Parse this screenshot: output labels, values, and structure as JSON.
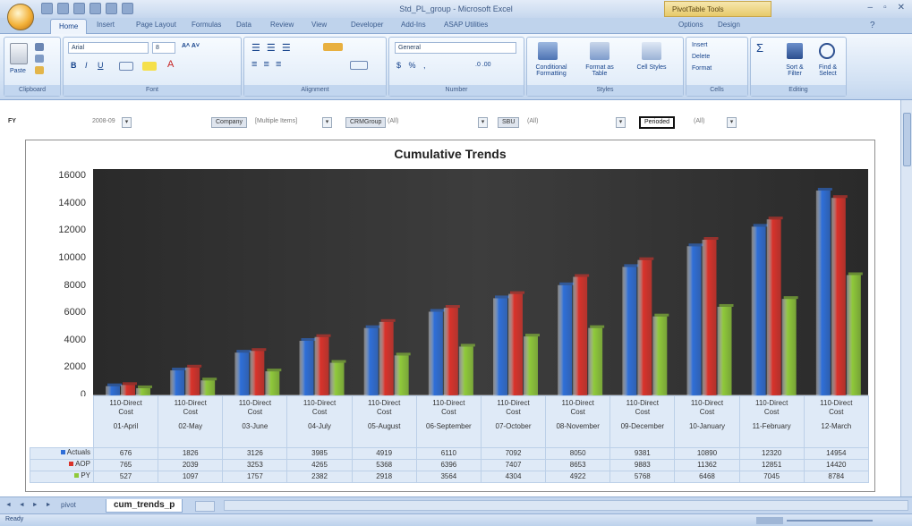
{
  "window": {
    "title": "Std_PL_group - Microsoft Excel",
    "contextual_tab": "PivotTable Tools",
    "controls": [
      "–",
      "▫",
      "✕"
    ]
  },
  "ribbon_tabs": [
    "Home",
    "Insert",
    "Page Layout",
    "Formulas",
    "Data",
    "Review",
    "View",
    "Developer",
    "Add-Ins",
    "ASAP Utilities",
    "Options",
    "Design"
  ],
  "ribbon": {
    "clipboard": {
      "paste": "Paste",
      "label": "Clipboard"
    },
    "font": {
      "name": "Arial",
      "size": "8",
      "label": "Font"
    },
    "alignment": {
      "label": "Alignment"
    },
    "number": {
      "format": "General",
      "label": "Number"
    },
    "styles": {
      "conditional": "Conditional Formatting",
      "format_table": "Format as Table",
      "cell_styles": "Cell Styles",
      "label": "Styles"
    },
    "cells": {
      "insert": "Insert",
      "delete": "Delete",
      "format": "Format",
      "label": "Cells"
    },
    "editing": {
      "sum": "Σ",
      "sort": "Sort & Filter",
      "find": "Find & Select",
      "label": "Editing"
    }
  },
  "filters": {
    "fy_label": "FY",
    "fy_value": "2008-09",
    "company_label": "Company",
    "company_value": "[Multiple Items]",
    "crm_label": "CRMGroup",
    "crm_value": "(All)",
    "sbu_label": "SBU",
    "sbu_value": "(All)",
    "period_label": "Perioded",
    "period_value": "(All)"
  },
  "chart_data": {
    "type": "bar",
    "title": "Cumulative Trends",
    "categories": [
      "01-April",
      "02-May",
      "03-June",
      "04-July",
      "05-August",
      "06-September",
      "07-October",
      "08-November",
      "09-December",
      "10-January",
      "11-February",
      "12-March"
    ],
    "category_group": "110-Direct Cost",
    "ylim": [
      0,
      16000
    ],
    "yticks": [
      0,
      2000,
      4000,
      6000,
      8000,
      10000,
      12000,
      14000,
      16000
    ],
    "series": [
      {
        "name": "Actuals",
        "color": "#2f6fd8",
        "values": [
          676,
          1826,
          3126,
          3985,
          4919,
          6110,
          7092,
          8050,
          9381,
          10890,
          12320,
          14954
        ]
      },
      {
        "name": "AOP",
        "color": "#d9332b",
        "values": [
          765,
          2039,
          3253,
          4265,
          5368,
          6396,
          7407,
          8653,
          9883,
          11362,
          12851,
          14420
        ]
      },
      {
        "name": "PY",
        "color": "#8fc93a",
        "values": [
          527,
          1097,
          1757,
          2382,
          2918,
          3564,
          4304,
          4922,
          5768,
          6468,
          7045,
          8784
        ]
      }
    ],
    "legend": "data-table",
    "grid": false
  },
  "sheet_tabs": [
    "pivot",
    "cum_trends_p"
  ],
  "active_sheet": "cum_trends_p",
  "status": {
    "ready": "Ready"
  }
}
